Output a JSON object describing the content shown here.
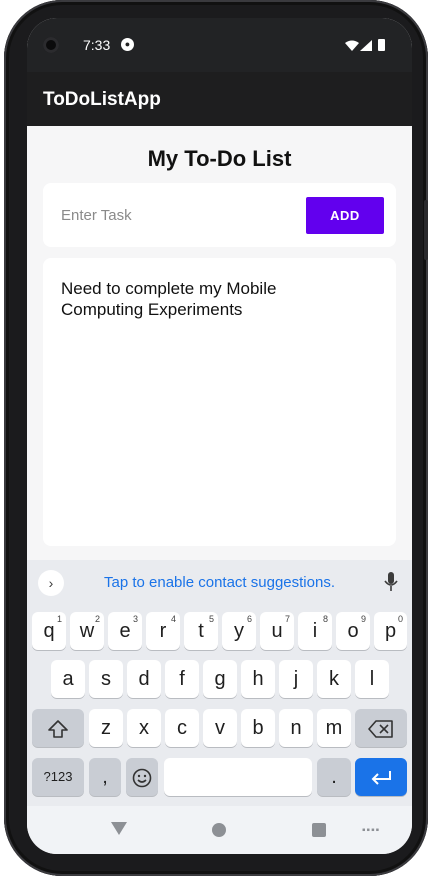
{
  "status_bar": {
    "time": "7:33",
    "notification_icon": "app-notification-icon",
    "icons": [
      "wifi-icon",
      "signal-icon",
      "battery-icon"
    ]
  },
  "app_bar": {
    "title": "ToDoListApp"
  },
  "main": {
    "title": "My To-Do List",
    "task_input": {
      "placeholder": "Enter Task",
      "value": ""
    },
    "add_button_label": "ADD",
    "tasks": [
      "Need to complete my Mobile Computing Experiments"
    ]
  },
  "keyboard": {
    "suggestion_text": "Tap to enable contact suggestions.",
    "row1": [
      "q",
      "w",
      "e",
      "r",
      "t",
      "y",
      "u",
      "i",
      "o",
      "p"
    ],
    "row1_hints": [
      "1",
      "2",
      "3",
      "4",
      "5",
      "6",
      "7",
      "8",
      "9",
      "0"
    ],
    "row2": [
      "a",
      "s",
      "d",
      "f",
      "g",
      "h",
      "j",
      "k",
      "l"
    ],
    "row3": [
      "z",
      "x",
      "c",
      "v",
      "b",
      "n",
      "m"
    ],
    "symbols_label": "?123",
    "comma_label": ",",
    "period_label": "."
  },
  "colors": {
    "accent": "#6200ee",
    "keyboard_enter": "#1a73e8",
    "app_bar": "#1e1e1f"
  }
}
